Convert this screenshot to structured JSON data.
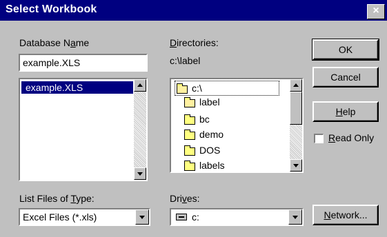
{
  "dialog": {
    "title": "Select Workbook",
    "close_label": "×"
  },
  "database_name": {
    "label_pre": "Database N",
    "label_ul": "a",
    "label_post": "me",
    "value": "example.XLS"
  },
  "file_list": {
    "items": [
      "example.XLS"
    ],
    "selected_index": 0
  },
  "directories": {
    "label_pre": "",
    "label_ul": "D",
    "label_post": "irectories:",
    "current_path": "c:\\label",
    "items": [
      {
        "name": "c:\\",
        "icon": "open-folder-icon"
      },
      {
        "name": "label",
        "icon": "open-folder-icon"
      },
      {
        "name": "bc",
        "icon": "folder-icon"
      },
      {
        "name": "demo",
        "icon": "folder-icon"
      },
      {
        "name": "DOS",
        "icon": "folder-icon"
      },
      {
        "name": "labels",
        "icon": "folder-icon"
      }
    ]
  },
  "file_type": {
    "label_pre": "List Files of ",
    "label_ul": "T",
    "label_post": "ype:",
    "value": "Excel Files (*.xls)"
  },
  "drives": {
    "label_pre": "Dri",
    "label_ul": "v",
    "label_post": "es:",
    "value": "c:"
  },
  "buttons": {
    "ok": "OK",
    "cancel": "Cancel",
    "help_ul": "H",
    "help_post": "elp",
    "network_ul": "N",
    "network_post": "etwork..."
  },
  "read_only": {
    "label_ul": "R",
    "label_post": "ead Only",
    "checked": false
  },
  "colors": {
    "titlebar": "#000080",
    "selection": "#000080",
    "face": "#c0c0c0"
  }
}
